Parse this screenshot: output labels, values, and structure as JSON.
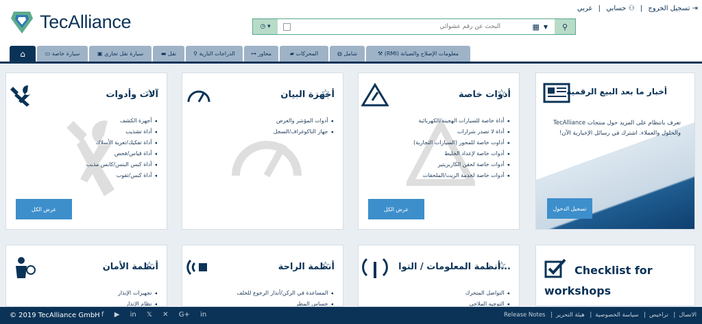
{
  "brand": {
    "name": "TecAlliance"
  },
  "toplinks": {
    "logout": "تسجيل الخروج",
    "account": "حسابي",
    "language": "عربي"
  },
  "search": {
    "placeholder": "البحث عن رقم عشوائي"
  },
  "tabs": [
    {
      "label": "معلومات الإصلاح والصيانة (RMI)"
    },
    {
      "label": "شامل"
    },
    {
      "label": "المحركات"
    },
    {
      "label": "محاور"
    },
    {
      "label": "الدراجات النارية"
    },
    {
      "label": "نقل"
    },
    {
      "label": "سيارة نقل تجاري"
    },
    {
      "label": "سيارة خاصة"
    }
  ],
  "cards": [
    {
      "title": "آلات وأدوات",
      "items": [
        "أجهزة الكشف",
        "أداة تشذيب",
        "أداة تفكيك/تعرية الأسلاك",
        "أداة قياس/فحص",
        "أداة كبس البنس/كابس مذبب",
        "أداة كبس/ثقوب"
      ],
      "button": "عرض الكل"
    },
    {
      "title": "أجهزة البيان",
      "items": [
        "أدوات المؤشر والعرض",
        "جهاز التاكوغراف/السجل"
      ]
    },
    {
      "title": "أدوات خاصة",
      "items": [
        "أداة خاصة للسيارات الهجينة/الكهربائية",
        "أداة لا تصدر شرارات",
        "أداوت خاصة للمحور (السيارات التجارية)",
        "أدوات خاصة لإعداد الخليط",
        "أدوات خاصة لحقن الكاربريتير",
        "أدوات خاصة لخدمة الزيت/الملحقات"
      ],
      "button": "عرض الكل"
    },
    {
      "title": "أنظمة الأمان",
      "items": [
        "تجهيزات الإنذار",
        "نظام الإنذار"
      ]
    },
    {
      "title": "أنظمة الراحة",
      "items": [
        "المساعدة في الركن/أنذار الرجوع للخلف",
        "حساس المطر"
      ]
    },
    {
      "title": "...أنظمة المعلومات / التوا",
      "items": [
        "التواصل المتحرك",
        "التوجيه الملاحي"
      ]
    }
  ],
  "news": {
    "title": "أخبار ما بعد البيع الرقمية",
    "text": "تعرف بانتظام على المزيد حول منتجات TecAlliance والحلول والعملاء. اشترك في رسائل الإخبارية الآن!",
    "button": "تسجيل الدخول"
  },
  "checklist": {
    "title": "Checklist for workshops"
  },
  "footer": {
    "copyright": "© 2019 TecAlliance GmbH",
    "social": [
      "f",
      "▶",
      "in",
      "𝕏",
      "✕",
      "G+",
      "in"
    ],
    "links": [
      "الاتصال",
      "تراخيص",
      "سياسة الخصوصية",
      "هيئة التحرير",
      "Release Notes"
    ]
  },
  "colors": {
    "primary": "#0b3357",
    "button": "#3d8fcb",
    "tab": "#9fb3c7"
  }
}
